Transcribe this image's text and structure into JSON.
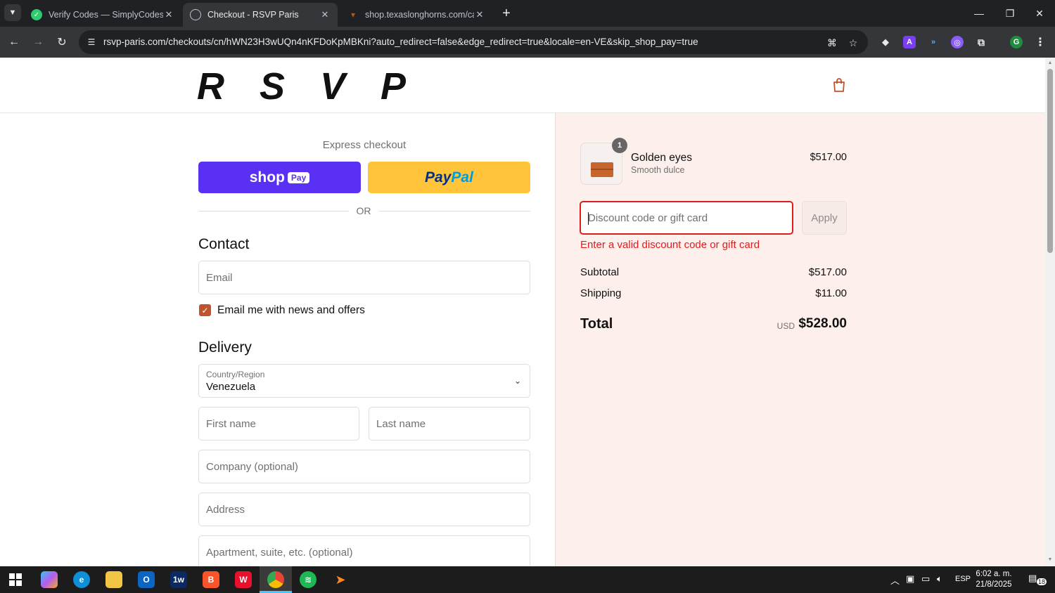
{
  "browser": {
    "tabs": [
      {
        "title": "Verify Codes — SimplyCodes",
        "icon": "simplycodes-icon",
        "active": false
      },
      {
        "title": "Checkout - RSVP Paris",
        "icon": "globe-icon",
        "active": true
      },
      {
        "title": "shop.texaslonghorns.com/cart",
        "icon": "longhorn-icon",
        "active": false
      }
    ],
    "url": "rsvp-paris.com/checkouts/cn/hWN23H3wUQn4nKFDoKpMBKni?auto_redirect=false&edge_redirect=true&locale=en-VE&skip_shop_pay=true",
    "profile_initial": "G"
  },
  "store": {
    "logo": "RSVP"
  },
  "checkout": {
    "express_label": "Express checkout",
    "shoppay_label": "shop",
    "shoppay_badge": "Pay",
    "paypal_label_a": "Pay",
    "paypal_label_b": "Pal",
    "or_label": "OR",
    "contact_heading": "Contact",
    "email_placeholder": "Email",
    "newsletter_label": "Email me with news and offers",
    "newsletter_checked": true,
    "delivery_heading": "Delivery",
    "country_label": "Country/Region",
    "country_value": "Venezuela",
    "first_name_placeholder": "First name",
    "last_name_placeholder": "Last name",
    "company_placeholder": "Company (optional)",
    "address_placeholder": "Address",
    "apartment_placeholder": "Apartment, suite, etc. (optional)"
  },
  "summary": {
    "item": {
      "quantity": "1",
      "name": "Golden eyes",
      "variant": "Smooth dulce",
      "price": "$517.00"
    },
    "discount_placeholder": "Discount code or gift card",
    "apply_label": "Apply",
    "error_text": "Enter a valid discount code or gift card",
    "subtotal_label": "Subtotal",
    "subtotal_value": "$517.00",
    "shipping_label": "Shipping",
    "shipping_value": "$11.00",
    "total_label": "Total",
    "total_currency": "USD",
    "total_value": "$528.00"
  },
  "taskbar": {
    "language": "ESP",
    "time": "6:02 a. m.",
    "date": "21/8/2025",
    "notifications": "18"
  },
  "colors": {
    "accent": "#c0532e",
    "error": "#dd1d1d",
    "shoppay": "#5a31f4",
    "paypal": "#ffc439",
    "summary_bg": "#fcefec"
  }
}
